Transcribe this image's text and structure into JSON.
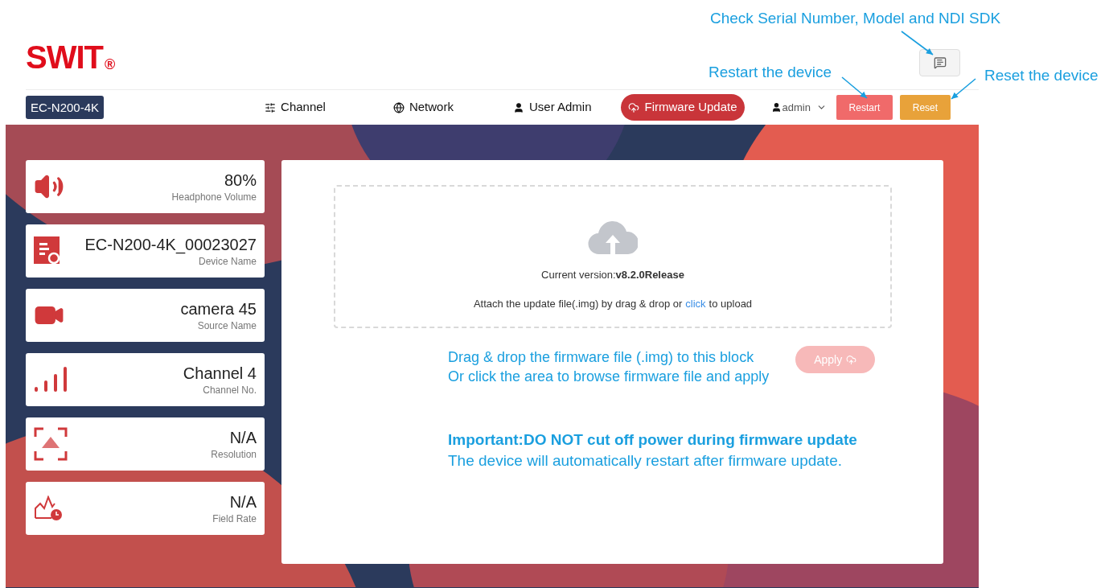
{
  "logo": {
    "text": "SWIT",
    "mark": "®"
  },
  "annotations": [
    {
      "text": "Check Serial Number, Model and NDI SDK"
    },
    {
      "text": "Restart the device"
    },
    {
      "text": "Reset the device"
    }
  ],
  "device_badge": "EC-N200-4K",
  "nav": [
    {
      "label": "Channel",
      "selected": false
    },
    {
      "label": "Network",
      "selected": false
    },
    {
      "label": "User Admin",
      "selected": false
    },
    {
      "label": "Firmware Update",
      "selected": true
    }
  ],
  "user_menu": {
    "label": "admin"
  },
  "buttons": {
    "restart": "Restart",
    "reset": "Reset"
  },
  "cards": [
    {
      "value": "80%",
      "label": "Headphone Volume"
    },
    {
      "value": "EC-N200-4K_00023027",
      "label": "Device Name"
    },
    {
      "value": "camera 45",
      "label": "Source Name"
    },
    {
      "value": "Channel 4",
      "label": "Channel No."
    },
    {
      "value": "N/A",
      "label": "Resolution"
    },
    {
      "value": "N/A",
      "label": "Field Rate"
    }
  ],
  "upload": {
    "version": "Current version:**v8.2.0Release**",
    "hint_before": "Attach the update file(.img) by drag & drop or",
    "hint_link": "click",
    "hint_after": "to upload"
  },
  "apply_button": {
    "label": "Apply",
    "disabled": true
  },
  "drop_note": [
    "Drag & drop the firmware file (.img) to this block",
    "Or click the area to browse firmware file and apply"
  ],
  "warning": {
    "title": "Important:DO NOT cut off power during firmware update",
    "text": "The device will automatically restart after firmware update."
  }
}
